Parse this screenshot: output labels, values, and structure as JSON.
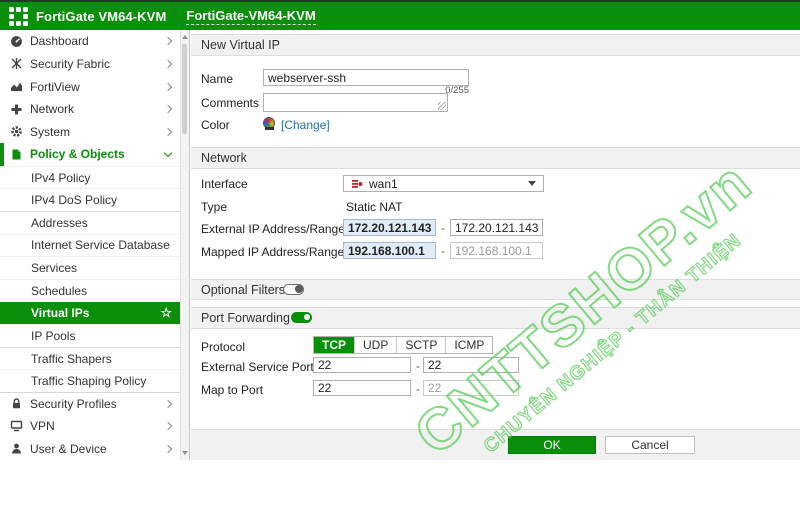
{
  "header": {
    "app_title": "FortiGate VM64-KVM",
    "hostname_tab": "FortiGate-VM64-KVM",
    "logo_icon": "fortinet-grid-logo"
  },
  "sidebar": {
    "items": [
      {
        "label": "Dashboard",
        "icon": "gauge-icon",
        "expandable": true
      },
      {
        "label": "Security Fabric",
        "icon": "fabric-icon",
        "expandable": true
      },
      {
        "label": "FortiView",
        "icon": "chart-icon",
        "expandable": true
      },
      {
        "label": "Network",
        "icon": "network-plus-icon",
        "expandable": true
      },
      {
        "label": "System",
        "icon": "gear-icon",
        "expandable": true
      },
      {
        "label": "Policy & Objects",
        "icon": "policy-doc-icon",
        "expanded": true,
        "active": true
      },
      {
        "label": "IPv4 Policy"
      },
      {
        "label": "IPv4 DoS Policy"
      },
      {
        "label": "Addresses"
      },
      {
        "label": "Internet Service Database"
      },
      {
        "label": "Services"
      },
      {
        "label": "Schedules"
      },
      {
        "label": "Virtual IPs",
        "selected": true,
        "star_icon": "favorite-star-icon"
      },
      {
        "label": "IP Pools"
      },
      {
        "label": "Traffic Shapers"
      },
      {
        "label": "Traffic Shaping Policy"
      },
      {
        "label": "Security Profiles",
        "icon": "lock-icon",
        "expandable": true
      },
      {
        "label": "VPN",
        "icon": "monitor-icon",
        "expandable": true
      },
      {
        "label": "User & Device",
        "icon": "user-icon",
        "expandable": true
      }
    ]
  },
  "form": {
    "title": "New Virtual IP",
    "name": {
      "label": "Name",
      "value": "webserver-ssh"
    },
    "comments": {
      "label": "Comments",
      "value": "",
      "counter": "0/255"
    },
    "color": {
      "label": "Color",
      "swatch_icon": "color-wheel-icon",
      "change_link": "[Change]"
    },
    "network_section_title": "Network",
    "interface": {
      "label": "Interface",
      "value": "wan1",
      "value_icon": "wan-interface-icon"
    },
    "type": {
      "label": "Type",
      "value": "Static NAT"
    },
    "external_ip": {
      "label": "External IP Address/Range",
      "from": "172.20.121.143",
      "to": "172.20.121.143"
    },
    "mapped_ip": {
      "label": "Mapped IP Address/Range",
      "from": "192.168.100.1",
      "to": "192.168.100.1"
    },
    "optional_filters": {
      "label": "Optional Filters",
      "enabled": false
    },
    "port_forwarding": {
      "label": "Port Forwarding",
      "enabled": true
    },
    "protocol": {
      "label": "Protocol",
      "options": [
        "TCP",
        "UDP",
        "SCTP",
        "ICMP"
      ],
      "selected": "TCP"
    },
    "external_service_port": {
      "label": "External Service Port",
      "from": "22",
      "to": "22"
    },
    "map_to_port": {
      "label": "Map to Port",
      "from": "22",
      "to": "22"
    },
    "range_sep": "-",
    "ok_label": "OK",
    "cancel_label": "Cancel"
  },
  "icons": {
    "star": "☆"
  },
  "watermark": {
    "line1": "CNTTSHOP.vn",
    "line2": "CHUYÊN NGHIỆP - THÂN THIỆN"
  },
  "colors": {
    "accent_green": "#0a8f0a",
    "link_blue": "#2470ae",
    "filled_input_bg": "#e1ecf9",
    "section_bar_bg": "#f1f1f1"
  }
}
